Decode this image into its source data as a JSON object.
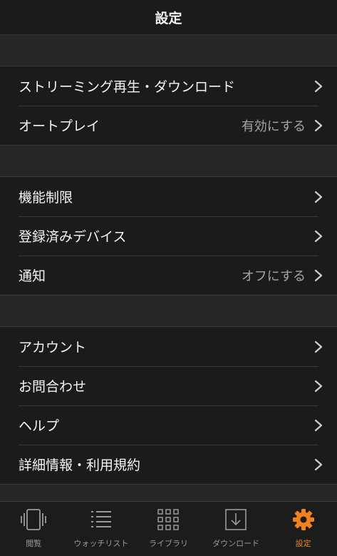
{
  "header": {
    "title": "設定"
  },
  "groups": [
    {
      "rows": [
        {
          "label": "ストリーミング再生・ダウンロード",
          "value": ""
        },
        {
          "label": "オートプレイ",
          "value": "有効にする"
        }
      ]
    },
    {
      "rows": [
        {
          "label": "機能制限",
          "value": ""
        },
        {
          "label": "登録済みデバイス",
          "value": ""
        },
        {
          "label": "通知",
          "value": "オフにする"
        }
      ]
    },
    {
      "rows": [
        {
          "label": "アカウント",
          "value": ""
        },
        {
          "label": "お問合わせ",
          "value": ""
        },
        {
          "label": "ヘルプ",
          "value": ""
        },
        {
          "label": "詳細情報・利用規約",
          "value": ""
        }
      ]
    }
  ],
  "tabbar": {
    "items": [
      {
        "label": "閲覧",
        "icon": "browse-icon"
      },
      {
        "label": "ウォッチリスト",
        "icon": "watchlist-icon"
      },
      {
        "label": "ライブラリ",
        "icon": "library-grid-icon"
      },
      {
        "label": "ダウンロード",
        "icon": "download-icon"
      },
      {
        "label": "設定",
        "icon": "gear-icon"
      }
    ],
    "active_color": "#f0821e",
    "inactive_color": "#9a9a9a"
  }
}
